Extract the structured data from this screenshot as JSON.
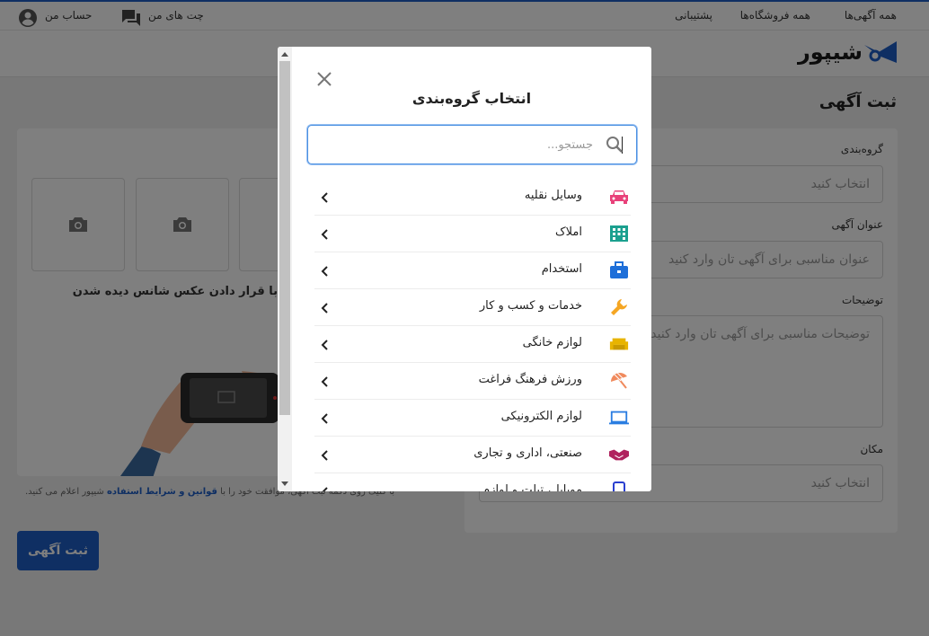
{
  "topbar": {
    "all_ads": "همه آگهی‌ها",
    "all_stores": "همه فروشگاه‌ها",
    "support": "پشتیبانی",
    "my_chats": "چت های من",
    "my_account": "حساب من"
  },
  "header": {
    "logo_text": "شیپور",
    "brand_color": "#1e5fc7"
  },
  "page": {
    "title": "ثبت آگهی"
  },
  "form": {
    "category_label": "گروه‌بندی",
    "category_placeholder": "انتخاب کنید",
    "ad_title_label": "عنوان آگهی",
    "ad_title_placeholder": "عنوان مناسبی برای آگهی تان وارد کنید",
    "description_label": "توضیحات",
    "description_placeholder": "توضیحات مناسبی برای آگهی تان وارد کنید",
    "location_label": "مکان",
    "location_placeholder": "انتخاب کنید"
  },
  "photos": {
    "hint": "با قرار دادن عکس شانس دیده شدن"
  },
  "terms": {
    "prefix": "با کلیک روی دکمه ثبت آگهی، موافقت خود را با",
    "link": "قوانین و شرایط استفاده",
    "suffix": "شیپور اعلام می کنید."
  },
  "submit_label": "ثبت آگهی",
  "modal": {
    "title": "انتخاب گروه‌بندی",
    "search_placeholder": "جستجو...",
    "categories": [
      {
        "label": "وسایل نقلیه",
        "icon": "car-icon",
        "color": "#e8417a"
      },
      {
        "label": "املاک",
        "icon": "building-icon",
        "color": "#1ba08f"
      },
      {
        "label": "استخدام",
        "icon": "briefcase-icon",
        "color": "#1e6fd9"
      },
      {
        "label": "خدمات و کسب و کار",
        "icon": "wrench-icon",
        "color": "#f5a623"
      },
      {
        "label": "لوازم خانگی",
        "icon": "sofa-icon",
        "color": "#e8b400"
      },
      {
        "label": "ورزش فرهنگ فراغت",
        "icon": "umbrella-icon",
        "color": "#f08a5d"
      },
      {
        "label": "لوازم الکترونیکی",
        "icon": "laptop-icon",
        "color": "#2a7de1"
      },
      {
        "label": "صنعتی، اداری و تجاری",
        "icon": "handshake-icon",
        "color": "#b0235f"
      },
      {
        "label": "موبایل، تبلت و لوازم",
        "icon": "mobile-icon",
        "color": "#2a3fd0"
      }
    ]
  }
}
